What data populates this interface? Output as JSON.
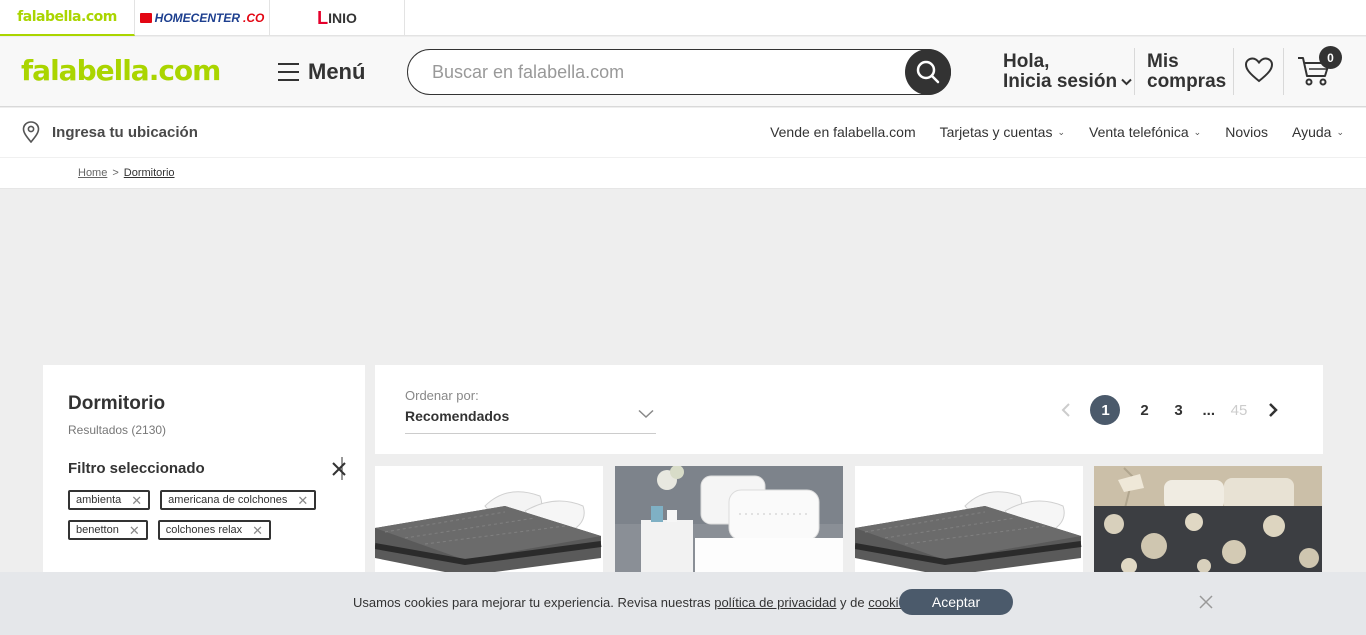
{
  "brand_tabs": [
    {
      "label": "falabella.com"
    },
    {
      "label": "HOMECENTER",
      "suffix": ".CO"
    },
    {
      "label": "INIO",
      "prefix": "L"
    }
  ],
  "header": {
    "logo": "falabella.com",
    "menu_label": "Menú",
    "search_placeholder": "Buscar en falabella.com",
    "greeting_line1": "Hola,",
    "greeting_line2": "Inicia sesión",
    "mis_compras_line1": "Mis",
    "mis_compras_line2": "compras",
    "cart_count": "0"
  },
  "nav": {
    "location_label": "Ingresa tu ubicación",
    "links": [
      "Vende en falabella.com",
      "Tarjetas y cuentas",
      "Venta telefónica",
      "Novios",
      "Ayuda"
    ]
  },
  "breadcrumb": {
    "home": "Home",
    "separator": ">",
    "current": "Dormitorio"
  },
  "filters": {
    "title": "Dormitorio",
    "results": "Resultados (2130)",
    "selected_title": "Filtro seleccionado",
    "chips": [
      "ambienta",
      "americana de colchones",
      "benetton",
      "colchones relax"
    ]
  },
  "sort": {
    "label": "Ordenar por:",
    "value": "Recomendados"
  },
  "pagination": {
    "pages": [
      "1",
      "2",
      "3"
    ],
    "ellipsis": "...",
    "last": "45",
    "current": "1"
  },
  "products": [
    {
      "icon": "mattress-image"
    },
    {
      "icon": "pillows-image"
    },
    {
      "icon": "mattress-image"
    },
    {
      "icon": "bedding-image"
    }
  ],
  "cookie": {
    "text_before": "Usamos cookies para mejorar tu experiencia. Revisa nuestras ",
    "privacy_link": "política de privacidad",
    "text_middle": " y de ",
    "cookies_link": "cookies",
    "text_after": ".",
    "accept_label": "Aceptar"
  },
  "colors": {
    "brand_green": "#aad500",
    "dark": "#333333",
    "accent_slate": "#4b5a6b"
  }
}
